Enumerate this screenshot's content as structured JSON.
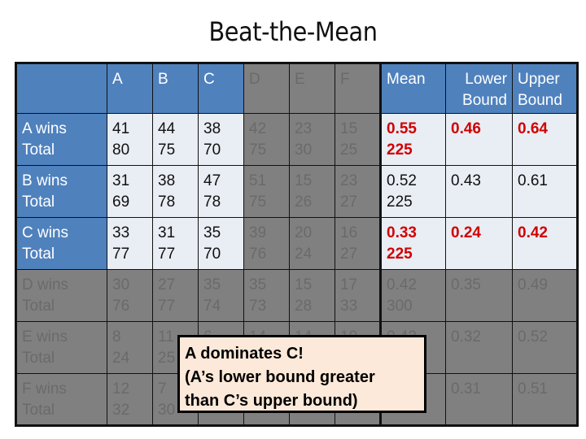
{
  "title": "Beat-the-Mean",
  "columns": [
    "",
    "A",
    "B",
    "C",
    "D",
    "E",
    "F",
    "Mean",
    "Lower Bound",
    "Upper Bound"
  ],
  "rows": [
    {
      "label1": "A wins",
      "label2": "Total",
      "cells": [
        [
          "41",
          "80"
        ],
        [
          "44",
          "75"
        ],
        [
          "38",
          "70"
        ],
        [
          "42",
          "75"
        ],
        [
          "23",
          "30"
        ],
        [
          "15",
          "25"
        ]
      ],
      "mean": [
        "0.55",
        "225"
      ],
      "lower": "0.46",
      "upper": "0.64",
      "highlight": true,
      "dim": false
    },
    {
      "label1": "B wins",
      "label2": "Total",
      "cells": [
        [
          "31",
          "69"
        ],
        [
          "38",
          "78"
        ],
        [
          "47",
          "78"
        ],
        [
          "51",
          "75"
        ],
        [
          "15",
          "26"
        ],
        [
          "23",
          "27"
        ]
      ],
      "mean": [
        "0.52",
        "225"
      ],
      "lower": "0.43",
      "upper": "0.61",
      "highlight": false,
      "dim": false
    },
    {
      "label1": "C wins",
      "label2": "Total",
      "cells": [
        [
          "33",
          "77"
        ],
        [
          "31",
          "77"
        ],
        [
          "35",
          "70"
        ],
        [
          "39",
          "76"
        ],
        [
          "20",
          "24"
        ],
        [
          "16",
          "27"
        ]
      ],
      "mean": [
        "0.33",
        "225"
      ],
      "lower": "0.24",
      "upper": "0.42",
      "highlight": true,
      "dim": false
    },
    {
      "label1": "D wins",
      "label2": "Total",
      "cells": [
        [
          "30",
          "76"
        ],
        [
          "27",
          "77"
        ],
        [
          "35",
          "74"
        ],
        [
          "35",
          "73"
        ],
        [
          "15",
          "28"
        ],
        [
          "17",
          "33"
        ]
      ],
      "mean": [
        "0.42",
        "300"
      ],
      "lower": "0.35",
      "upper": "0.49",
      "highlight": false,
      "dim": true
    },
    {
      "label1": "E wins",
      "label2": "Total",
      "cells": [
        [
          "8",
          "24"
        ],
        [
          "11",
          "25"
        ],
        [
          "6",
          ""
        ],
        [
          "14",
          ""
        ],
        [
          "14",
          ""
        ],
        [
          "10",
          ""
        ]
      ],
      "mean": [
        "0.42",
        ""
      ],
      "lower": "0.32",
      "upper": "0.52",
      "highlight": false,
      "dim": true
    },
    {
      "label1": "F wins",
      "label2": "Total",
      "cells": [
        [
          "12",
          "32"
        ],
        [
          "7",
          "30"
        ],
        [
          "",
          ""
        ],
        [
          "",
          ""
        ],
        [
          "",
          ""
        ],
        [
          "",
          ""
        ]
      ],
      "mean": [
        "",
        ""
      ],
      "lower": "0.31",
      "upper": "0.51",
      "highlight": false,
      "dim": true
    }
  ],
  "callout": {
    "line1": "A dominates C!",
    "line2": "(A’s lower bound greater",
    "line3": "than C’s upper bound)"
  },
  "colors": {
    "header": "#4f81bd",
    "cell": "#e9edf4",
    "eliminated": "#808080",
    "highlight": "#d00000",
    "callout": "#fde9d9"
  }
}
